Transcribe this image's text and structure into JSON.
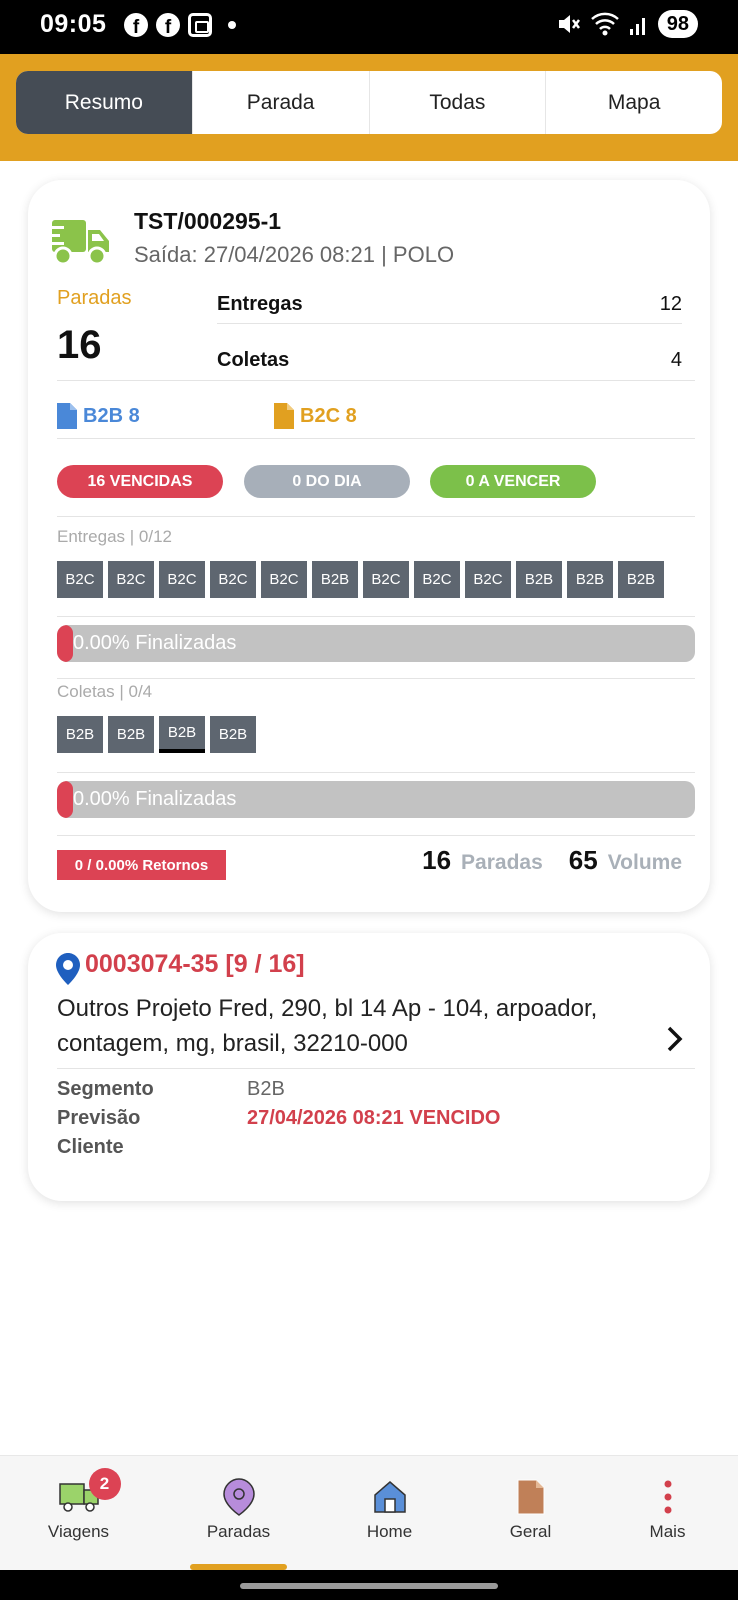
{
  "status_bar": {
    "time": "09:05",
    "battery": "98"
  },
  "tabs": [
    {
      "label": "Resumo",
      "active": true
    },
    {
      "label": "Parada",
      "active": false
    },
    {
      "label": "Todas",
      "active": false
    },
    {
      "label": "Mapa",
      "active": false
    }
  ],
  "trip": {
    "code": "TST/000295-1",
    "subtitle": "Saída: 27/04/2026 08:21 | POLO",
    "paradas_label": "Paradas",
    "paradas_value": "16",
    "entregas_label": "Entregas",
    "entregas_value": "12",
    "coletas_label": "Coletas",
    "coletas_value": "4",
    "b2b_label": "B2B 8",
    "b2c_label": "B2C 8",
    "status_pills": {
      "vencidas": "16 VENCIDAS",
      "do_dia": "0 DO DIA",
      "a_vencer": "0 A VENCER"
    },
    "entregas_section": {
      "label": "Entregas | 0/12",
      "chips": [
        "B2C",
        "B2C",
        "B2C",
        "B2C",
        "B2C",
        "B2B",
        "B2C",
        "B2C",
        "B2C",
        "B2B",
        "B2B",
        "B2B"
      ],
      "progress_text": "0.00% Finalizadas",
      "progress": 0
    },
    "coletas_section": {
      "label": "Coletas | 0/4",
      "chips": [
        "B2B",
        "B2B",
        "B2B",
        "B2B"
      ],
      "selected_index": 2,
      "progress_text": "0.00% Finalizadas",
      "progress": 0
    },
    "retornos": "0 / 0.00% Retornos",
    "totals": {
      "paradas_num": "16",
      "paradas_unit": "Paradas",
      "volume_num": "65",
      "volume_unit": "Volume"
    }
  },
  "stop": {
    "title": "0003074-35 [9 / 16]",
    "address": "Outros Projeto Fred, 290, bl 14 Ap - 104, arpoador, contagem, mg, brasil, 32210-000",
    "segmento_label": "Segmento",
    "segmento_value": "B2B",
    "previsao_label": "Previsão",
    "previsao_value": "27/04/2026 08:21 VENCIDO",
    "cliente_label": "Cliente"
  },
  "bottom_nav": [
    {
      "label": "Viagens",
      "icon": "truck-icon",
      "badge": "2"
    },
    {
      "label": "Paradas",
      "icon": "map-pin-icon",
      "active": true
    },
    {
      "label": "Home",
      "icon": "home-icon"
    },
    {
      "label": "Geral",
      "icon": "document-icon"
    },
    {
      "label": "Mais",
      "icon": "more-vertical-icon"
    }
  ],
  "colors": {
    "accent": "#e1a020",
    "danger": "#dc4354",
    "b2b_blue": "#4a88d8",
    "success": "#7cc04a",
    "tab_active": "#454c55"
  }
}
